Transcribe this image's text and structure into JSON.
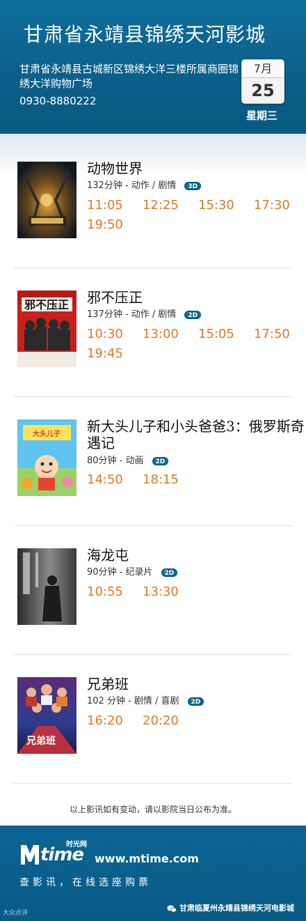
{
  "header": {
    "cinema_name": "甘肃省永靖县锦绣天河影城",
    "address": "甘肃省永靖县古城新区锦绣大洋三楼所属商圈锦绣大洋购物广场",
    "phone": "0930-8880222",
    "date": {
      "month": "7月",
      "day": "25",
      "weekday": "星期三"
    }
  },
  "movies": [
    {
      "title": "动物世界",
      "meta": "132分钟 - 动作 / 剧情",
      "format": "3D",
      "showtimes": [
        "11:05",
        "12:25",
        "15:30",
        "17:30",
        "19:50"
      ],
      "poster_icon": "poster-animal-world"
    },
    {
      "title": "邪不压正",
      "meta": "137分钟 - 动作 / 剧情",
      "format": "2D",
      "showtimes": [
        "10:30",
        "13:00",
        "15:05",
        "17:50",
        "19:45"
      ],
      "poster_icon": "poster-hidden-man"
    },
    {
      "title": "新大头儿子和小头爸爸3：俄罗斯奇遇记",
      "meta": "80分钟 - 动画",
      "format": "2D",
      "showtimes": [
        "14:50",
        "18:15"
      ],
      "poster_icon": "poster-big-head-son"
    },
    {
      "title": "海龙屯",
      "meta": "90分钟 - 纪录片",
      "format": "2D",
      "showtimes": [
        "10:55",
        "13:30"
      ],
      "poster_icon": "poster-hailongtun"
    },
    {
      "title": "兄弟班",
      "meta": "102 分钟 - 剧情 / 喜剧",
      "format": "2D",
      "showtimes": [
        "16:20",
        "20:20"
      ],
      "poster_icon": "poster-brothers-class"
    }
  ],
  "notice": "以上影讯如有变动，请以影院当日公布为准。",
  "footer": {
    "logo_text": "time",
    "logo_cn": "时光网",
    "url": "www.mtime.com",
    "slogan": "查影讯，在线选座购票",
    "wechat_account": "甘肃临夏州永靖县锦绣天河电影城",
    "watermark": "大众点评"
  },
  "colors": {
    "header_bg": "#0b6590",
    "showtime": "#e0782a",
    "badge": "#0b6b93"
  }
}
